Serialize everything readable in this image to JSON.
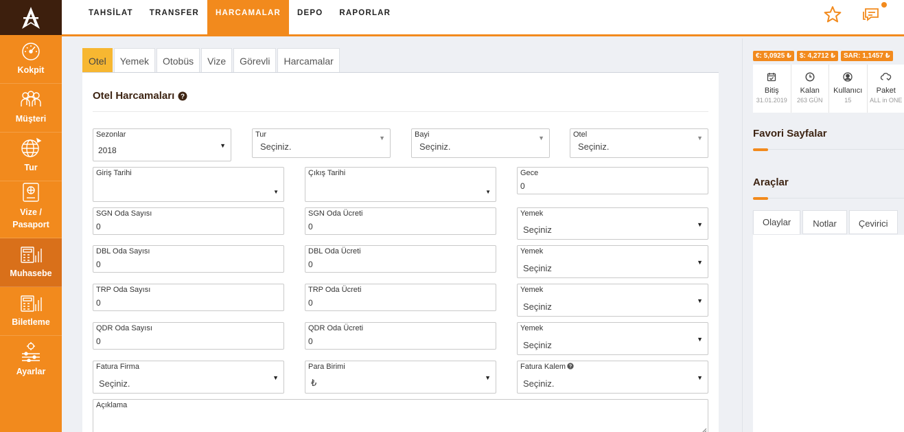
{
  "sidebar": {
    "items": [
      {
        "label": "Kokpit",
        "icon": "speedometer-icon"
      },
      {
        "label": "Müşteri",
        "icon": "customers-icon"
      },
      {
        "label": "Tur",
        "icon": "globe-icon"
      },
      {
        "label": "Vize / Pasaport",
        "icon": "passport-icon"
      },
      {
        "label": "Muhasebe",
        "icon": "accounting-icon"
      },
      {
        "label": "Biletleme",
        "icon": "ticketing-icon"
      },
      {
        "label": "Ayarlar",
        "icon": "settings-icon"
      }
    ],
    "active": "Muhasebe"
  },
  "topnav": {
    "items": [
      "TAHSİLAT",
      "TRANSFER",
      "HARCAMALAR",
      "DEPO",
      "RAPORLAR"
    ],
    "active": "HARCAMALAR"
  },
  "tabs": [
    "Otel",
    "Yemek",
    "Otobüs",
    "Vize",
    "Görevli",
    "Harcamalar"
  ],
  "active_tab": "Otel",
  "form": {
    "title": "Otel Harcamaları",
    "sezonlar": {
      "label": "Sezonlar",
      "value": "2018"
    },
    "tur": {
      "label": "Tur",
      "value": "Seçiniz."
    },
    "bayi": {
      "label": "Bayi",
      "value": "Seçiniz."
    },
    "otel": {
      "label": "Otel",
      "value": "Seçiniz."
    },
    "giris": {
      "label": "Giriş Tarihi",
      "value": ""
    },
    "cikis": {
      "label": "Çıkış Tarihi",
      "value": ""
    },
    "gece": {
      "label": "Gece",
      "value": "0"
    },
    "sgn_sayi": {
      "label": "SGN Oda Sayısı",
      "value": "0"
    },
    "sgn_ucret": {
      "label": "SGN Oda Ücreti",
      "value": "0"
    },
    "sgn_yemek": {
      "label": "Yemek",
      "value": "Seçiniz"
    },
    "dbl_sayi": {
      "label": "DBL Oda Sayısı",
      "value": "0"
    },
    "dbl_ucret": {
      "label": "DBL Oda Ücreti",
      "value": "0"
    },
    "dbl_yemek": {
      "label": "Yemek",
      "value": "Seçiniz"
    },
    "trp_sayi": {
      "label": "TRP Oda Sayısı",
      "value": "0"
    },
    "trp_ucret": {
      "label": "TRP Oda Ücreti",
      "value": "0"
    },
    "trp_yemek": {
      "label": "Yemek",
      "value": "Seçiniz"
    },
    "qdr_sayi": {
      "label": "QDR Oda Sayısı",
      "value": "0"
    },
    "qdr_ucret": {
      "label": "QDR Oda Ücreti",
      "value": "0"
    },
    "qdr_yemek": {
      "label": "Yemek",
      "value": "Seçiniz"
    },
    "fatura_firma": {
      "label": "Fatura Firma",
      "value": "Seçiniz."
    },
    "para_birimi": {
      "label": "Para Birimi",
      "value": "₺"
    },
    "fatura_kalem": {
      "label": "Fatura Kalem",
      "value": "Seçiniz."
    },
    "aciklama": {
      "label": "Açıklama",
      "value": ""
    }
  },
  "rates": [
    "€: 5,0925 ₺",
    "$: 4,2712 ₺",
    "SAR: 1,1457 ₺"
  ],
  "stats": [
    {
      "label": "Bitiş",
      "value": "31.01.2019",
      "icon": "calendar-check-icon"
    },
    {
      "label": "Kalan",
      "value": "263 GÜN",
      "icon": "clock-icon"
    },
    {
      "label": "Kullanıcı",
      "value": "15",
      "icon": "user-circle-icon"
    },
    {
      "label": "Paket",
      "value": "ALL in ONE",
      "icon": "cloud-icon"
    }
  ],
  "favorites_title": "Favori Sayfalar",
  "tools_title": "Araçlar",
  "tool_tabs": [
    "Olaylar",
    "Notlar",
    "Çevirici"
  ],
  "active_tool_tab": "Olaylar",
  "colors": {
    "accent": "#f28a1d",
    "dark": "#3d1f0d",
    "tab_active": "#f7b731"
  }
}
